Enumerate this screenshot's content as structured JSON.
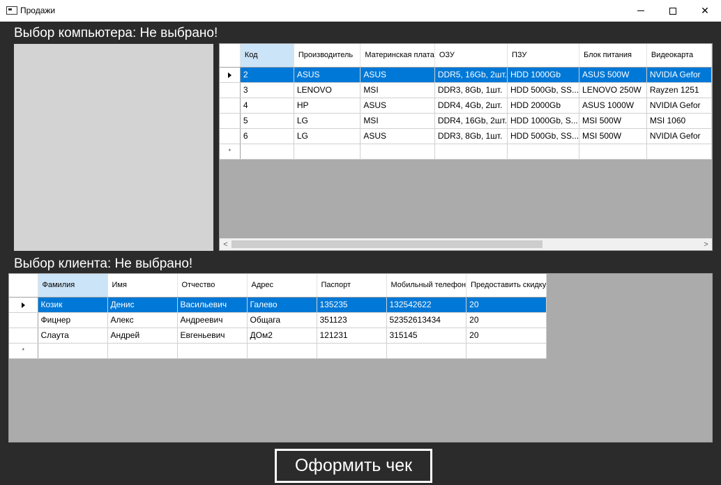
{
  "window": {
    "title": "Продажи",
    "minimize_glyph": "—",
    "maximize_glyph": "☐",
    "close_glyph": "✕"
  },
  "computer_section": {
    "label": "Выбор компьютера: Не выбрано!",
    "columns": [
      "Код",
      "Производитель",
      "Материнская плата",
      "ОЗУ",
      "ПЗУ",
      "Блок питания",
      "Видеокарта"
    ],
    "rows": [
      [
        "2",
        "ASUS",
        "ASUS",
        "DDR5, 16Gb, 2шт.",
        "HDD 1000Gb",
        "ASUS 500W",
        "NVIDIA Gefor"
      ],
      [
        "3",
        "LENOVO",
        "MSI",
        "DDR3, 8Gb, 1шт.",
        "HDD 500Gb, SS...",
        "LENOVO 250W",
        "Rayzen 1251"
      ],
      [
        "4",
        "HP",
        "ASUS",
        "DDR4, 4Gb, 2шт.",
        "HDD 2000Gb",
        "ASUS 1000W",
        "NVIDIA Gefor"
      ],
      [
        "5",
        "LG",
        "MSI",
        "DDR4, 16Gb, 2шт.",
        "HDD 1000Gb, S...",
        "MSI 500W",
        "MSI 1060"
      ],
      [
        "6",
        "LG",
        "ASUS",
        "DDR3, 8Gb, 1шт.",
        "HDD 500Gb, SS...",
        "MSI 500W",
        "NVIDIA Gefor"
      ]
    ],
    "selected_row": 0,
    "new_row_marker": "*",
    "scroll_left_glyph": "<",
    "scroll_right_glyph": ">"
  },
  "client_section": {
    "label": "Выбор клиента: Не выбрано!",
    "columns": [
      "Фамилия",
      "Имя",
      "Отчество",
      "Адрес",
      "Паспорт",
      "Мобильный телефон",
      "Предоставить скидку"
    ],
    "rows": [
      [
        "Козик",
        "Денис",
        "Васильевич",
        "Галево",
        "135235",
        "132542622",
        "20"
      ],
      [
        "Фицнер",
        "Алекс",
        "Андреевич",
        "Общага",
        "351123",
        "52352613434",
        "20"
      ],
      [
        "Слаута",
        "Андрей",
        "Евгеньевич",
        "ДОм2",
        "121231",
        "315145",
        "20"
      ]
    ],
    "selected_row": 0,
    "new_row_marker": "*"
  },
  "checkout_button": {
    "label": "Оформить чек"
  },
  "colors": {
    "background": "#2b2b2b",
    "selection": "#0078d7",
    "sorted_header": "#cce4f7",
    "grid_empty": "#ababab"
  }
}
